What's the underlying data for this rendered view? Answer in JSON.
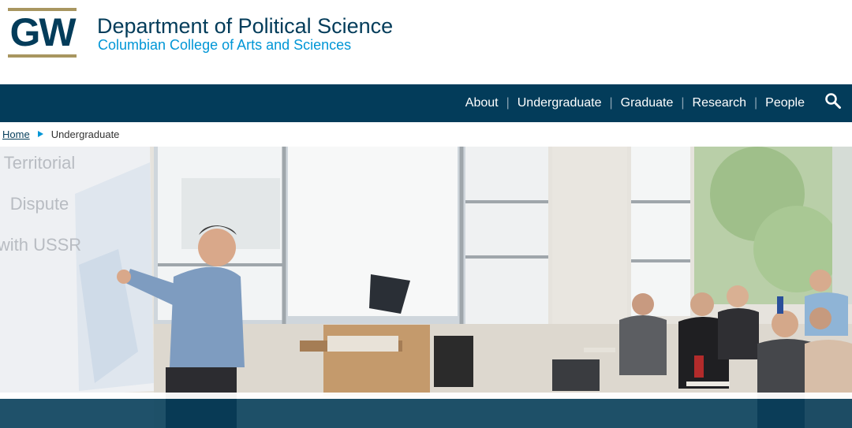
{
  "header": {
    "logo_text": "GW",
    "title": "Department of Political Science",
    "subtitle": "Columbian College of Arts and Sciences"
  },
  "nav": {
    "items": [
      {
        "label": "About"
      },
      {
        "label": "Undergraduate"
      },
      {
        "label": "Graduate"
      },
      {
        "label": "Research"
      },
      {
        "label": "People"
      }
    ],
    "separator": "|",
    "search_icon": "search-icon"
  },
  "breadcrumb": {
    "home": "Home",
    "current": "Undergraduate"
  },
  "hero": {
    "slide_text": [
      "Territorial",
      "Dispute",
      "with USSR"
    ]
  },
  "colors": {
    "brand_navy": "#033c5a",
    "brand_blue": "#0096d6",
    "brand_gold": "#a89660"
  }
}
